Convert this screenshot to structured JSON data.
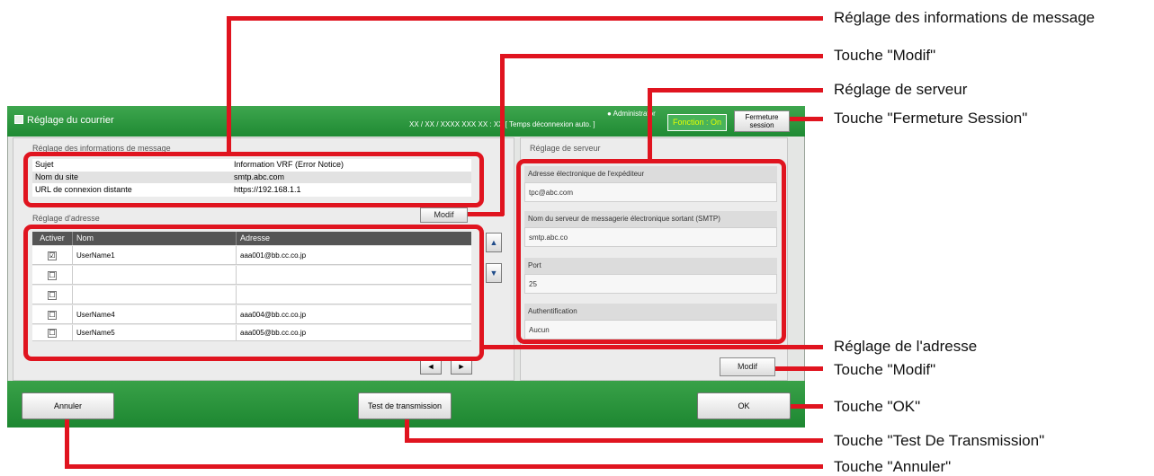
{
  "window": {
    "title": "Réglage du courrier",
    "datetime": "XX / XX / XXXX  XXX  XX : XX",
    "auto_logout": "[ Temps déconnexion auto. ]",
    "user": "Administrator",
    "function_button": "Fonction : On",
    "logout_button_line1": "Fermeture",
    "logout_button_line2": "session"
  },
  "message": {
    "section_label": "Réglage des informations de message",
    "rows": [
      {
        "label": "Sujet",
        "value": "Information VRF (Error Notice)"
      },
      {
        "label": "Nom du site",
        "value": "smtp.abc.com"
      },
      {
        "label": "URL de connexion distante",
        "value": "https://192.168.1.1"
      }
    ],
    "modify_button": "Modif"
  },
  "address": {
    "section_label": "Réglage d'adresse",
    "columns": [
      "Activer",
      "Nom",
      "Adresse"
    ],
    "rows": [
      {
        "checked": "☑",
        "name": "UserName1",
        "address": "aaa001@bb.cc.co.jp"
      },
      {
        "checked": "☐",
        "name": "",
        "address": ""
      },
      {
        "checked": "☐",
        "name": "",
        "address": ""
      },
      {
        "checked": "☐",
        "name": "UserName4",
        "address": "aaa004@bb.cc.co.jp"
      },
      {
        "checked": "☐",
        "name": "UserName5",
        "address": "aaa005@bb.cc.co.jp"
      }
    ],
    "up_arrow": "▲",
    "down_arrow": "▼",
    "prev_arrow": "◄",
    "next_arrow": "►"
  },
  "server": {
    "section_label": "Réglage de serveur",
    "sender_label": "Adresse électronique de l'expéditeur",
    "sender_value": "tpc@abc.com",
    "smtp_label": "Nom du serveur de messagerie électronique sortant (SMTP)",
    "smtp_value": "smtp.abc.co",
    "port_label": "Port",
    "port_value": "25",
    "auth_label": "Authentification",
    "auth_value": "Aucun",
    "modify_button": "Modif"
  },
  "footer": {
    "cancel_button": "Annuler",
    "test_button": "Test de transmission",
    "ok_button": "OK"
  },
  "callouts": {
    "message_settings": "Réglage des informations de message",
    "modify_top": "Touche \"Modif\"",
    "server_settings": "Réglage de serveur",
    "logout": "Touche \"Fermeture Session\"",
    "address_settings": "Réglage de l'adresse",
    "modify_bottom": "Touche \"Modif\"",
    "ok": "Touche \"OK\"",
    "test": "Touche \"Test De Transmission\"",
    "cancel": "Touche \"Annuler\""
  },
  "colors": {
    "highlight": "#e0141f",
    "titlebar": "#2e9a40"
  }
}
